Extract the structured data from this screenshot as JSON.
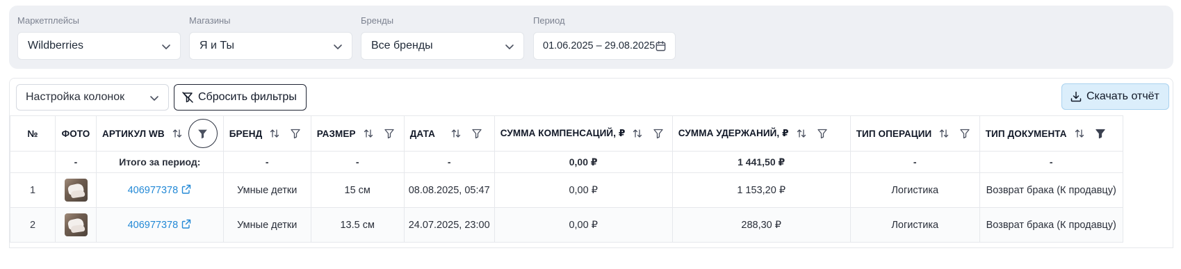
{
  "filters": {
    "marketplaces": {
      "label": "Маркетплейсы",
      "value": "Wildberries"
    },
    "stores": {
      "label": "Магазины",
      "value": "Я и Ты"
    },
    "brands": {
      "label": "Бренды",
      "value": "Все бренды"
    },
    "period": {
      "label": "Период",
      "value": "01.06.2025 – 29.08.2025"
    }
  },
  "toolbar": {
    "columns_label": "Настройка колонок",
    "reset_label": "Сбросить фильтры",
    "download_label": "Скачать отчёт"
  },
  "table": {
    "headers": {
      "num": "№",
      "photo": "ФОТО",
      "article": "АРТИКУЛ WB",
      "brand": "БРЕНД",
      "size": "РАЗМЕР",
      "date": "ДАТА",
      "compensation": "СУММА КОМПЕНСАЦИЙ, ₽",
      "deduction": "СУММА УДЕРЖАНИЙ, ₽",
      "operation": "ТИП ОПЕРАЦИИ",
      "document": "ТИП ДОКУМЕНТА"
    },
    "total": {
      "photo": "-",
      "article": "Итого за период:",
      "brand": "-",
      "size": "-",
      "date": "-",
      "compensation": "0,00 ₽",
      "deduction": "1 441,50 ₽",
      "operation": "-",
      "document": "-"
    },
    "rows": [
      {
        "num": "1",
        "article": "406977378",
        "brand": "Умные детки",
        "size": "15 см",
        "date": "08.08.2025, 05:47",
        "compensation": "0,00 ₽",
        "deduction": "1 153,20 ₽",
        "operation": "Логистика",
        "document": "Возврат брака (К продавцу)"
      },
      {
        "num": "2",
        "article": "406977378",
        "brand": "Умные детки",
        "size": "13.5 см",
        "date": "24.07.2025, 23:00",
        "compensation": "0,00 ₽",
        "deduction": "288,30 ₽",
        "operation": "Логистика",
        "document": "Возврат брака (К продавцу)"
      }
    ]
  },
  "colors": {
    "filter_panel_bg": "#eef0f4",
    "link": "#2389d6",
    "download_bg": "#dbeefb"
  }
}
